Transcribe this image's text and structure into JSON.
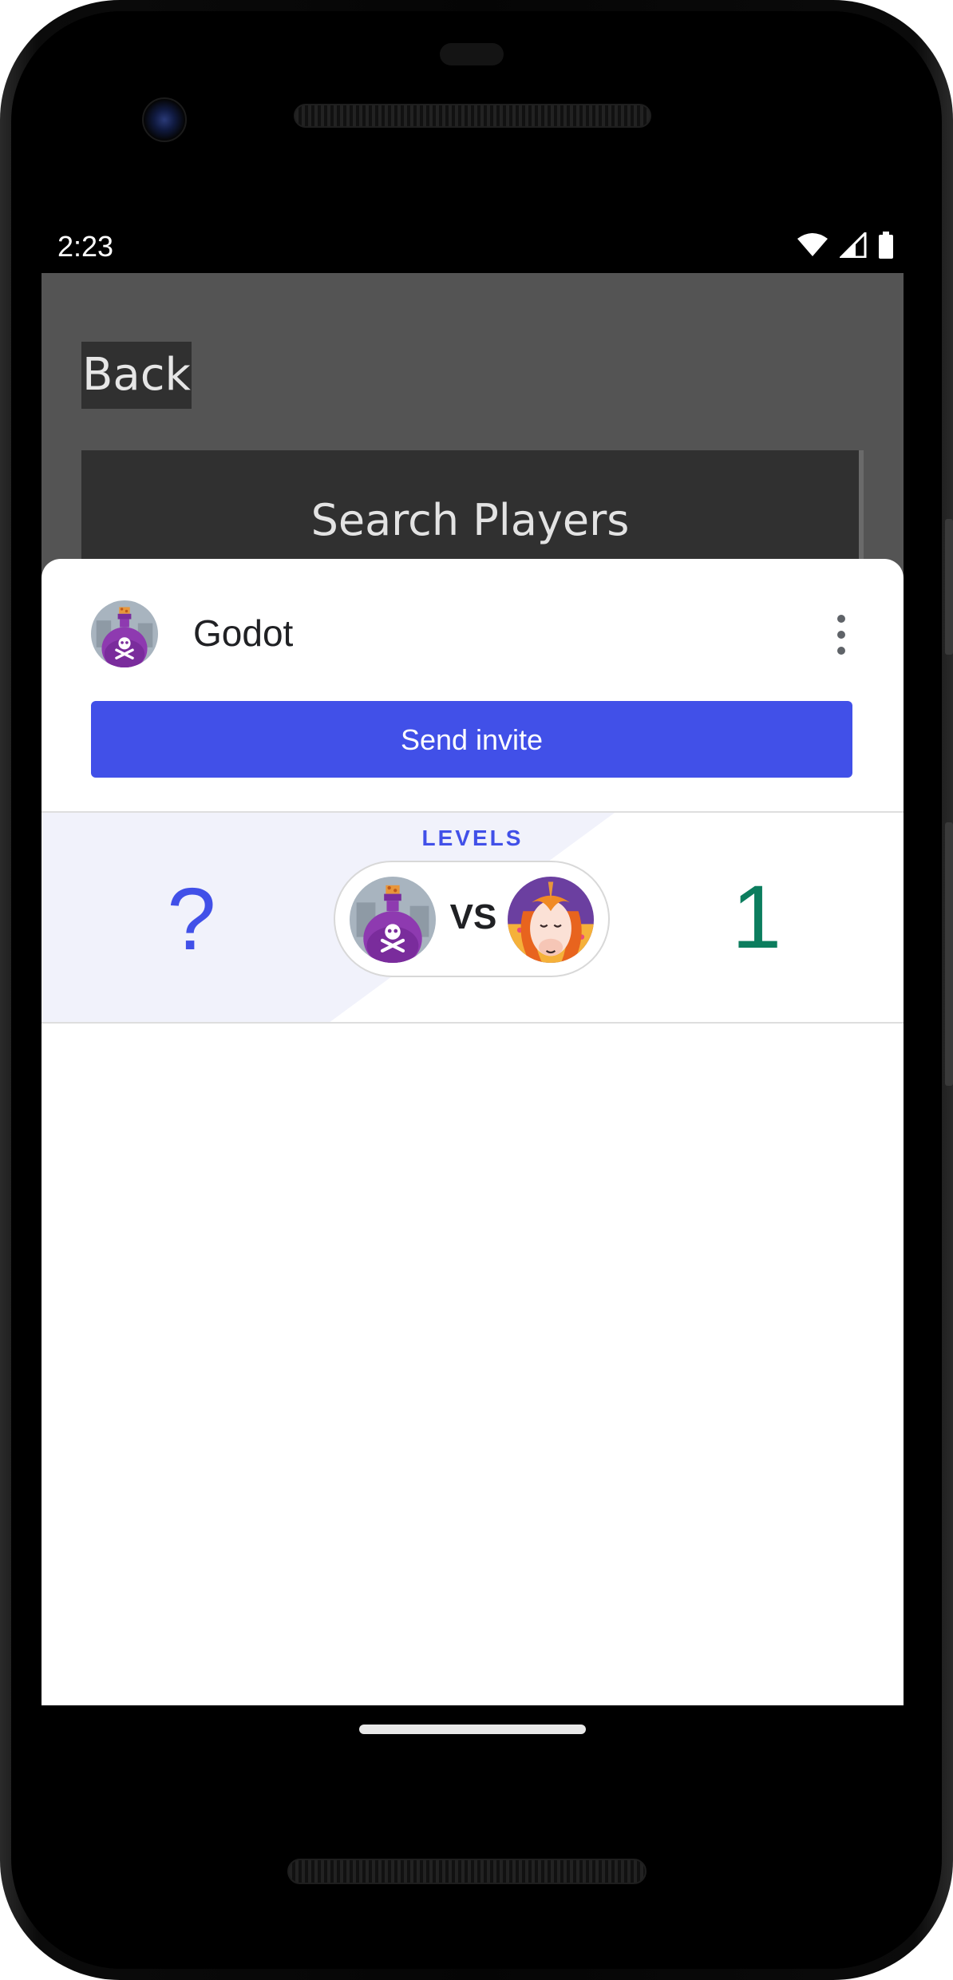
{
  "status_bar": {
    "time": "2:23",
    "icons": [
      "wifi-icon",
      "cell-signal-icon",
      "battery-icon"
    ]
  },
  "background_screen": {
    "back_label": "Back",
    "search_title": "Search Players"
  },
  "sheet": {
    "player_name": "Godot",
    "player_avatar": "poison-bottle-avatar",
    "menu_icon": "more-vert-icon",
    "invite_label": "Send invite",
    "levels": {
      "label": "LEVELS",
      "left_score": "?",
      "right_score": "1",
      "vs_label": "VS",
      "left_avatar": "poison-bottle-avatar",
      "right_avatar": "unicorn-avatar"
    }
  },
  "colors": {
    "accent": "#4150e8",
    "score_green": "#0c7d5e",
    "dim_background": "#545454"
  }
}
